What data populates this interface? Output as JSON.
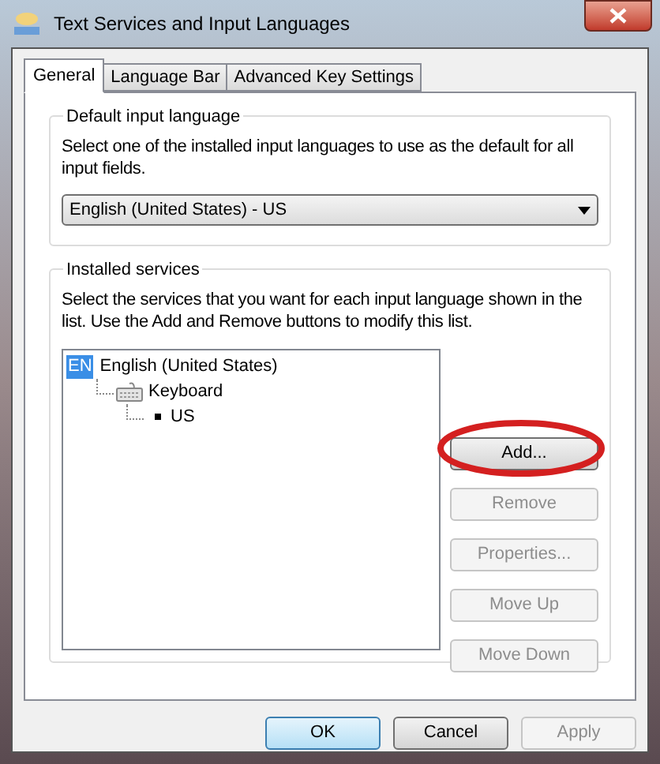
{
  "window": {
    "title": "Text Services and Input Languages"
  },
  "tabs": [
    {
      "label": "General",
      "selected": true
    },
    {
      "label": "Language Bar",
      "selected": false
    },
    {
      "label": "Advanced Key Settings",
      "selected": false
    }
  ],
  "default_language": {
    "title": "Default input language",
    "description": "Select one of the installed input languages to use as the default for all input fields.",
    "dropdown": {
      "value": "English (United States) - US"
    }
  },
  "installed_services": {
    "title": "Installed services",
    "description": "Select the services that you want for each input language shown in the list. Use the Add and Remove buttons to modify this list.",
    "tree": [
      {
        "label": "English (United States)",
        "kind": "language",
        "badge": "EN",
        "children": [
          {
            "label": "Keyboard",
            "kind": "category",
            "children": [
              {
                "label": "US",
                "kind": "service"
              }
            ]
          }
        ]
      }
    ],
    "buttons": [
      {
        "label": "Add...",
        "disabled": false,
        "highlighted": true
      },
      {
        "label": "Remove",
        "disabled": true,
        "highlighted": false
      },
      {
        "label": "Properties...",
        "disabled": true,
        "highlighted": false
      },
      {
        "label": "Move Up",
        "disabled": true,
        "highlighted": false
      },
      {
        "label": "Move Down",
        "disabled": true,
        "highlighted": false
      }
    ]
  },
  "dialog_buttons": [
    {
      "label": "OK",
      "disabled": false,
      "default": true
    },
    {
      "label": "Cancel",
      "disabled": false,
      "default": false
    },
    {
      "label": "Apply",
      "disabled": true,
      "default": false
    }
  ]
}
